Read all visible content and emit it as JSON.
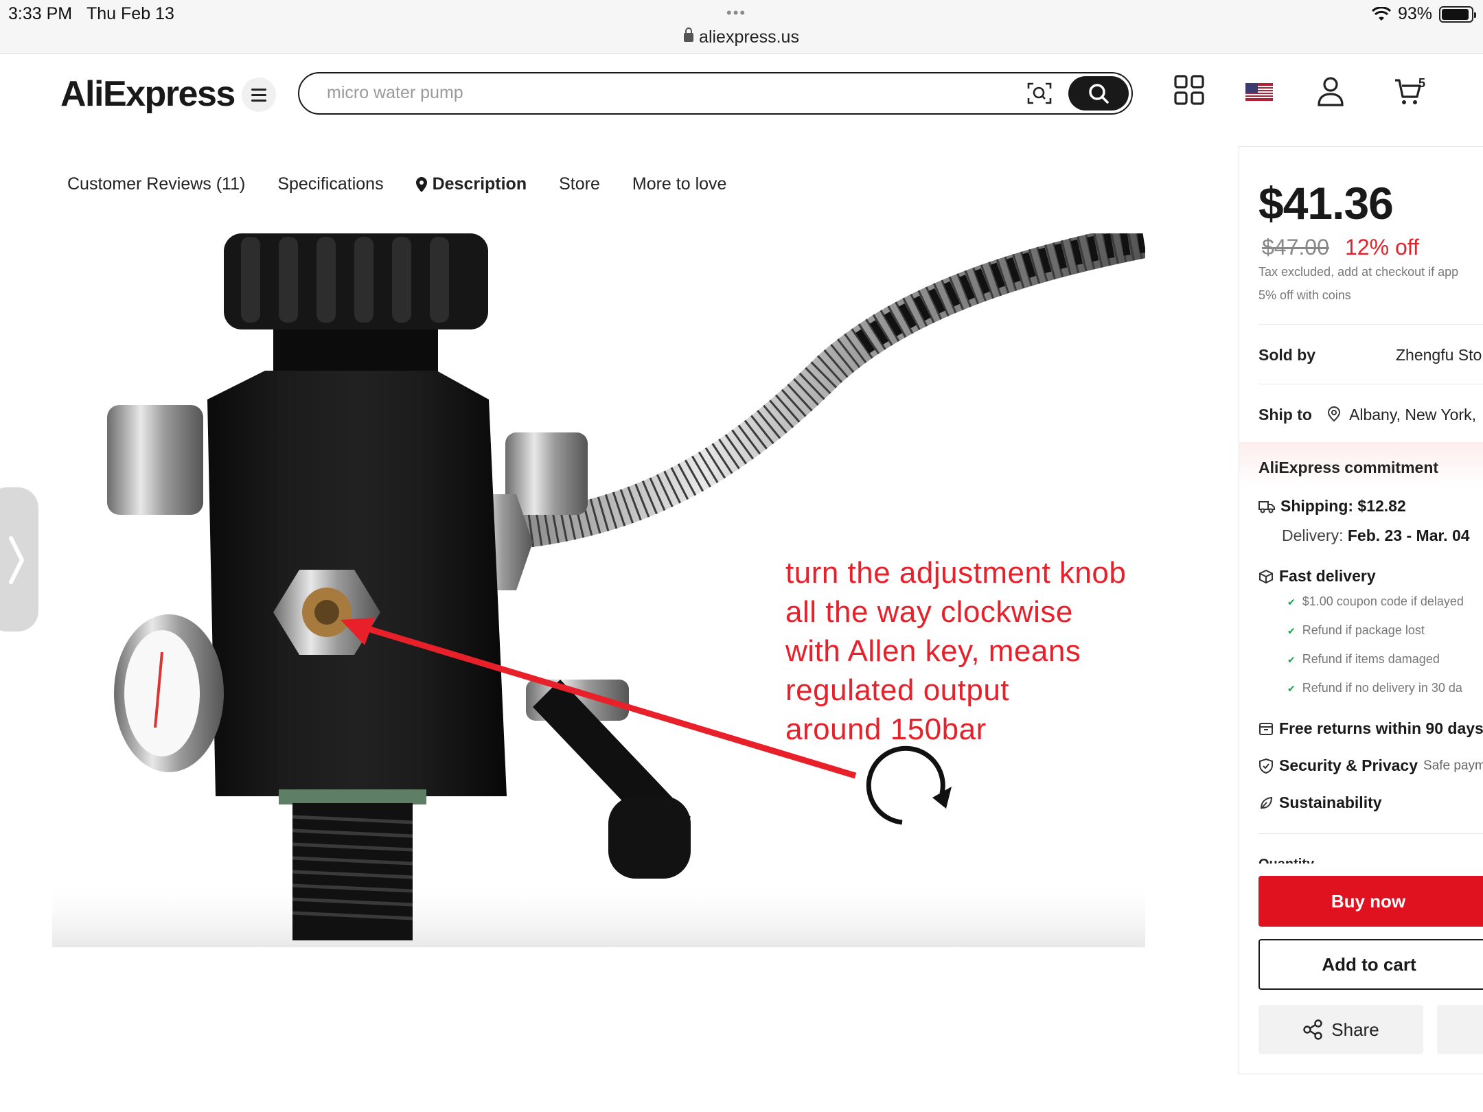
{
  "status_bar": {
    "time": "3:33 PM",
    "date": "Thu Feb 13",
    "dots": "•••",
    "battery": "93%",
    "battery_level": 0.93,
    "url": "aliexpress.us"
  },
  "header": {
    "logo": "AliExpress",
    "search_placeholder": "micro water pump",
    "cart_count": "5"
  },
  "tabs": [
    {
      "label": "Customer Reviews (11)"
    },
    {
      "label": "Specifications"
    },
    {
      "label": "Description",
      "active": true
    },
    {
      "label": "Store"
    },
    {
      "label": "More to love"
    }
  ],
  "annotation": {
    "lines": [
      "turn the adjustment knob",
      "all the way clockwise",
      "with Allen key, means",
      "regulated output",
      "around 150bar"
    ],
    "color": "#e8202a"
  },
  "panel": {
    "price": "$41.36",
    "original_price": "$47.00",
    "discount": "12% off",
    "tax_note": "Tax excluded, add at checkout if app",
    "coins_note": "5% off with coins",
    "sold_by_label": "Sold by",
    "sold_by_value": "Zhengfu Sto",
    "ship_to_label": "Ship to",
    "ship_to_value": "Albany, New York,",
    "commitment_title": "AliExpress commitment",
    "shipping": "Shipping: $12.82",
    "delivery_label": "Delivery:",
    "delivery_value": "Feb. 23 - Mar. 04",
    "fast_delivery": "Fast delivery",
    "checks": [
      "$1.00 coupon code if delayed",
      "Refund if package lost",
      "Refund if items damaged",
      "Refund if no delivery in 30 da"
    ],
    "free_returns": "Free returns within 90 days",
    "security": "Security & Privacy",
    "security_sub": "Safe paym",
    "sustainability": "Sustainability",
    "quantity_peek": "Quantity",
    "buy_now": "Buy now",
    "add_to_cart": "Add to cart",
    "share": "Share"
  },
  "colors": {
    "accent_red": "#e1121f",
    "brand_dark": "#191919",
    "check_green": "#16a34a"
  }
}
